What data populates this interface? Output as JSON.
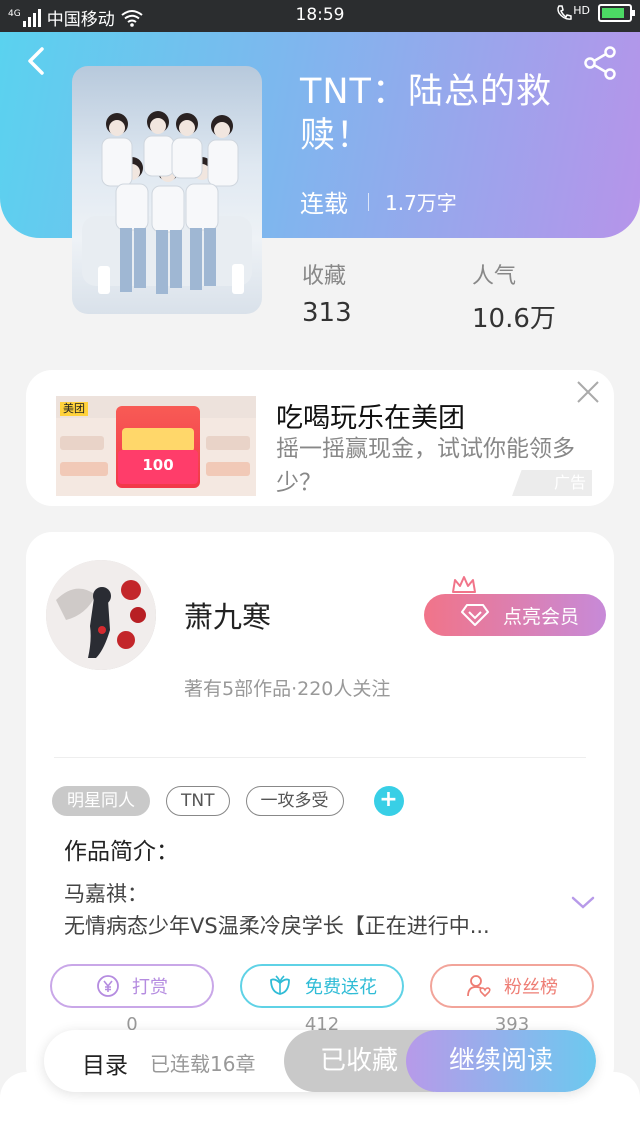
{
  "status_bar": {
    "network": "4G",
    "carrier": "中国移动",
    "time": "18:59",
    "hd": "HD"
  },
  "book": {
    "title": "TNT：陆总的救赎！",
    "status": "连载",
    "word_count": "1.7万字",
    "favorites_label": "收藏",
    "favorites_value": "313",
    "popularity_label": "人气",
    "popularity_value": "10.6万"
  },
  "ad": {
    "image_brand": "美团",
    "image_amount": "100",
    "title": "吃喝玩乐在美团",
    "description": "摇一摇赢现金，试试你能领多少？",
    "tag": "广告"
  },
  "author": {
    "name": "萧九寒",
    "info": "著有5部作品·220人关注",
    "vip_button": "点亮会员"
  },
  "tags": [
    "明星同人",
    "TNT",
    "一攻多受"
  ],
  "intro": {
    "heading": "作品简介：",
    "line1": "马嘉祺：",
    "line2": "无情病态少年VS温柔冷戾学长【正在进行中..."
  },
  "actions": {
    "reward_label": "打赏",
    "reward_count": "0",
    "flower_label": "免费送花",
    "flower_count": "412",
    "fans_label": "粉丝榜",
    "fans_count": "393"
  },
  "bottom_bar": {
    "toc_label": "目录",
    "chapters": "已连载16章",
    "favorited_label": "已收藏",
    "continue_label": "继续阅读"
  },
  "colors": {
    "header_gradient_start": "#5ad2ef",
    "header_gradient_end": "#b694ea",
    "accent_cyan": "#38cfe6",
    "vip_pink": "#f17489"
  }
}
